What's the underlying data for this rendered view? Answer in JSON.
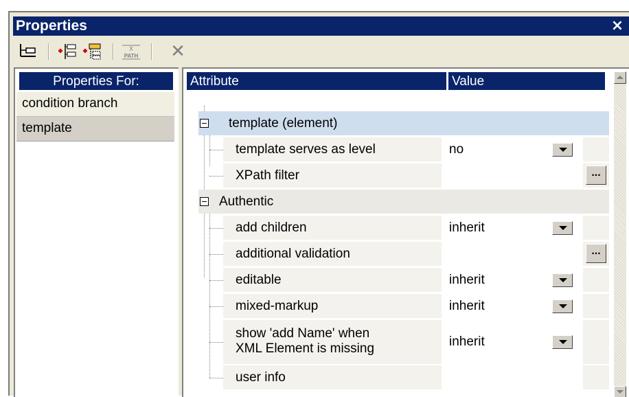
{
  "window": {
    "title": "Properties",
    "close_glyph": "×"
  },
  "toolbar": {
    "buttons": [
      {
        "name": "element-tree-icon"
      },
      {
        "name": "add-attribute-icon"
      },
      {
        "name": "add-attribute-group-icon"
      },
      {
        "name": "xpath-icon"
      },
      {
        "name": "delete-icon"
      }
    ],
    "xpath_top": "X",
    "xpath_bottom": "PATH",
    "delete_glyph": "✕"
  },
  "left_panel": {
    "header": "Properties For:",
    "items": [
      "condition branch",
      "template"
    ],
    "selected": "template"
  },
  "grid": {
    "columns": {
      "attribute": "Attribute",
      "value": "Value"
    },
    "groups": [
      {
        "label": "template (element)",
        "highlighted": true,
        "rows": [
          {
            "attribute": "template serves as level",
            "value": "no",
            "control": "dropdown"
          },
          {
            "attribute": "XPath filter",
            "value": "",
            "control": "ellipsis"
          }
        ]
      },
      {
        "label": "Authentic",
        "highlighted": false,
        "rows": [
          {
            "attribute": "add children",
            "value": "inherit",
            "control": "dropdown"
          },
          {
            "attribute": "additional validation",
            "value": "",
            "control": "ellipsis"
          },
          {
            "attribute": "editable",
            "value": "inherit",
            "control": "dropdown"
          },
          {
            "attribute": "mixed-markup",
            "value": "inherit",
            "control": "dropdown"
          },
          {
            "attribute": "show 'add Name' when",
            "attribute_line2": "XML Element is missing",
            "value": "inherit",
            "control": "dropdown"
          },
          {
            "attribute": "user info",
            "value": "",
            "control": "none"
          }
        ]
      }
    ],
    "ellipsis_label": "..."
  },
  "colors": {
    "title_bar": "#0a246a",
    "header": "#0a246a",
    "highlight_group": "#cfdeee",
    "group_row": "#eae9e4",
    "selected_item": "#d4d0c8",
    "panel_bg": "#ece9d8"
  }
}
